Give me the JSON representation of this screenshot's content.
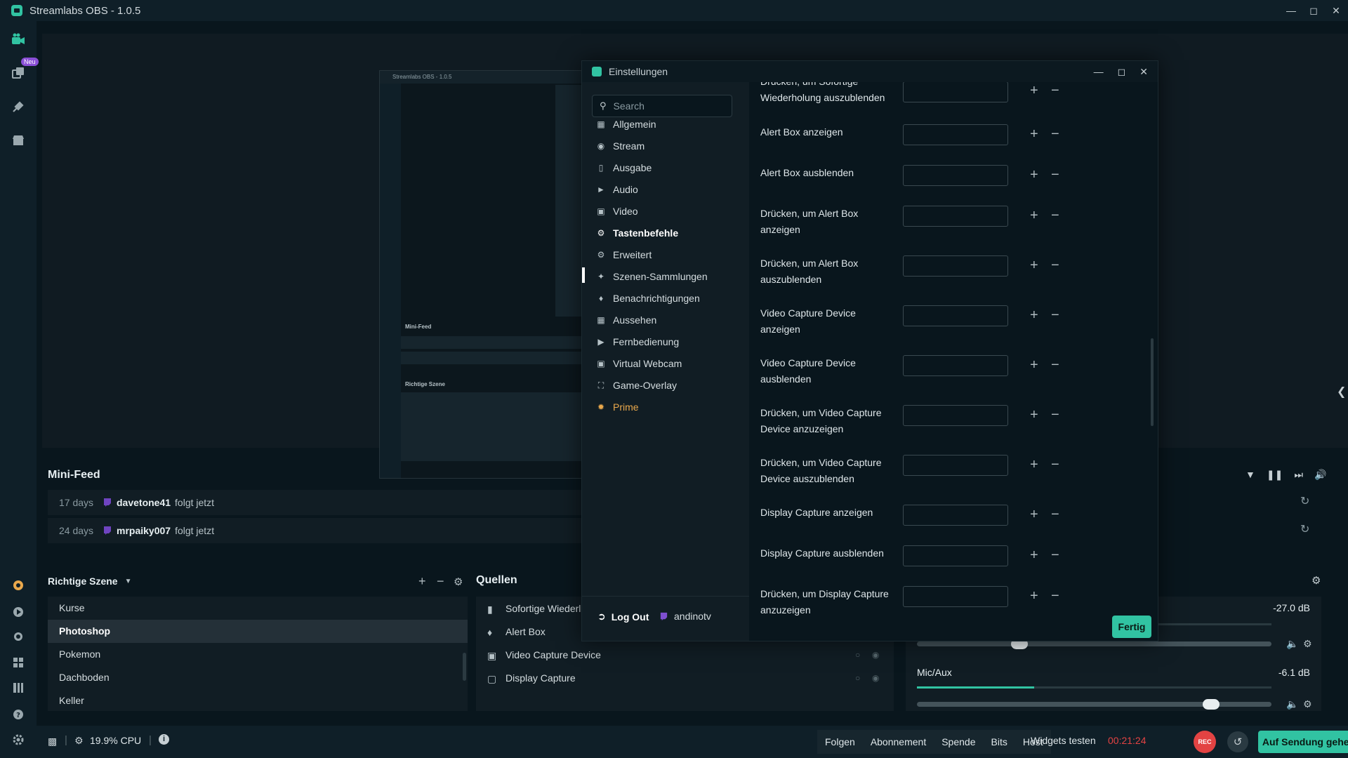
{
  "window": {
    "title": "Streamlabs OBS - 1.0.5"
  },
  "leftnav": {
    "badge": "Neu"
  },
  "mini_screen": {
    "title": "Streamlabs OBS - 1.0.5",
    "minifeed": "Mini-Feed",
    "scenes": "Richtige Szene"
  },
  "minifeed": {
    "title": "Mini-Feed",
    "items": [
      {
        "days": "17 days",
        "user": "davetone41",
        "action": "folgt jetzt"
      },
      {
        "days": "24 days",
        "user": "mrpaiky007",
        "action": "folgt jetzt"
      }
    ]
  },
  "scenes": {
    "title": "Richtige Szene",
    "items": [
      "Kurse",
      "Photoshop",
      "Pokemon",
      "Dachboden",
      "Keller"
    ],
    "active_index": 1
  },
  "sources": {
    "title": "Quellen",
    "items": [
      "Sofortige Wiederl",
      "Alert Box",
      "Video Capture Device",
      "Display Capture"
    ]
  },
  "mixer": {
    "tracks": [
      {
        "name": "",
        "db": "-27.0 dB",
        "level": 0.0,
        "volume": 0.29
      },
      {
        "name": "Mic/Aux",
        "db": "-6.1 dB",
        "level": 0.33,
        "volume": 0.83
      }
    ]
  },
  "statusbar": {
    "cpu": "19.9% CPU",
    "buttons": [
      "Folgen",
      "Abonnement",
      "Spende",
      "Bits",
      "Host"
    ],
    "widgets_test": "Widgets testen",
    "timer": "00:21:24",
    "rec": "REC",
    "go_live": "Auf Sendung gehen",
    "colors": {
      "accent": "#31c3a2",
      "timer": "#e34343",
      "rec": "#e34343"
    }
  },
  "settings": {
    "title": "Einstellungen",
    "search_placeholder": "Search",
    "categories": [
      {
        "label": "Allgemein",
        "icon": "grid-icon"
      },
      {
        "label": "Stream",
        "icon": "globe-icon"
      },
      {
        "label": "Ausgabe",
        "icon": "output-icon"
      },
      {
        "label": "Audio",
        "icon": "speaker-icon"
      },
      {
        "label": "Video",
        "icon": "film-icon"
      },
      {
        "label": "Tastenbefehle",
        "icon": "gear-icon"
      },
      {
        "label": "Erweitert",
        "icon": "gears-icon"
      },
      {
        "label": "Szenen-Sammlungen",
        "icon": "collections-icon"
      },
      {
        "label": "Benachrichtigungen",
        "icon": "bell-icon"
      },
      {
        "label": "Aussehen",
        "icon": "appearance-icon"
      },
      {
        "label": "Fernbedienung",
        "icon": "remote-icon"
      },
      {
        "label": "Virtual Webcam",
        "icon": "camera-icon"
      },
      {
        "label": "Game-Overlay",
        "icon": "overlay-icon"
      },
      {
        "label": "Prime",
        "icon": "prime-icon"
      }
    ],
    "active_category": "Tastenbefehle",
    "logout": "Log Out",
    "account": "andinotv",
    "hotkeys": [
      "Drücken, um Sofortige Wiederholung auszublenden",
      "Alert Box anzeigen",
      "Alert Box ausblenden",
      "Drücken, um Alert Box anzeigen",
      "Drücken, um Alert Box auszublenden",
      "Video Capture Device anzeigen",
      "Video Capture Device ausblenden",
      "Drücken, um Video Capture Device anzuzeigen",
      "Drücken, um Video Capture Device auszublenden",
      "Display Capture anzeigen",
      "Display Capture ausblenden",
      "Drücken, um Display Capture anzuzeigen"
    ],
    "done": "Fertig"
  }
}
